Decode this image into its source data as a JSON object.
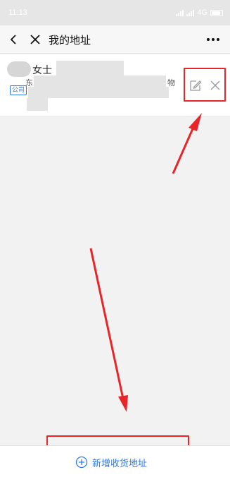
{
  "status": {
    "time": "11:13",
    "network": "4G"
  },
  "nav": {
    "title": "我的地址"
  },
  "address": {
    "name": "女士",
    "tag": "公司",
    "line_prefix": "东",
    "line_suffix": "物"
  },
  "footer": {
    "add_label": "新增收货地址"
  },
  "colors": {
    "accent": "#2f7ae6",
    "annotation": "#e8262a",
    "background": "#f2f2f2"
  },
  "icons": [
    "back-icon",
    "close-icon",
    "more-icon",
    "edit-icon",
    "delete-icon",
    "plus-circle-icon"
  ]
}
